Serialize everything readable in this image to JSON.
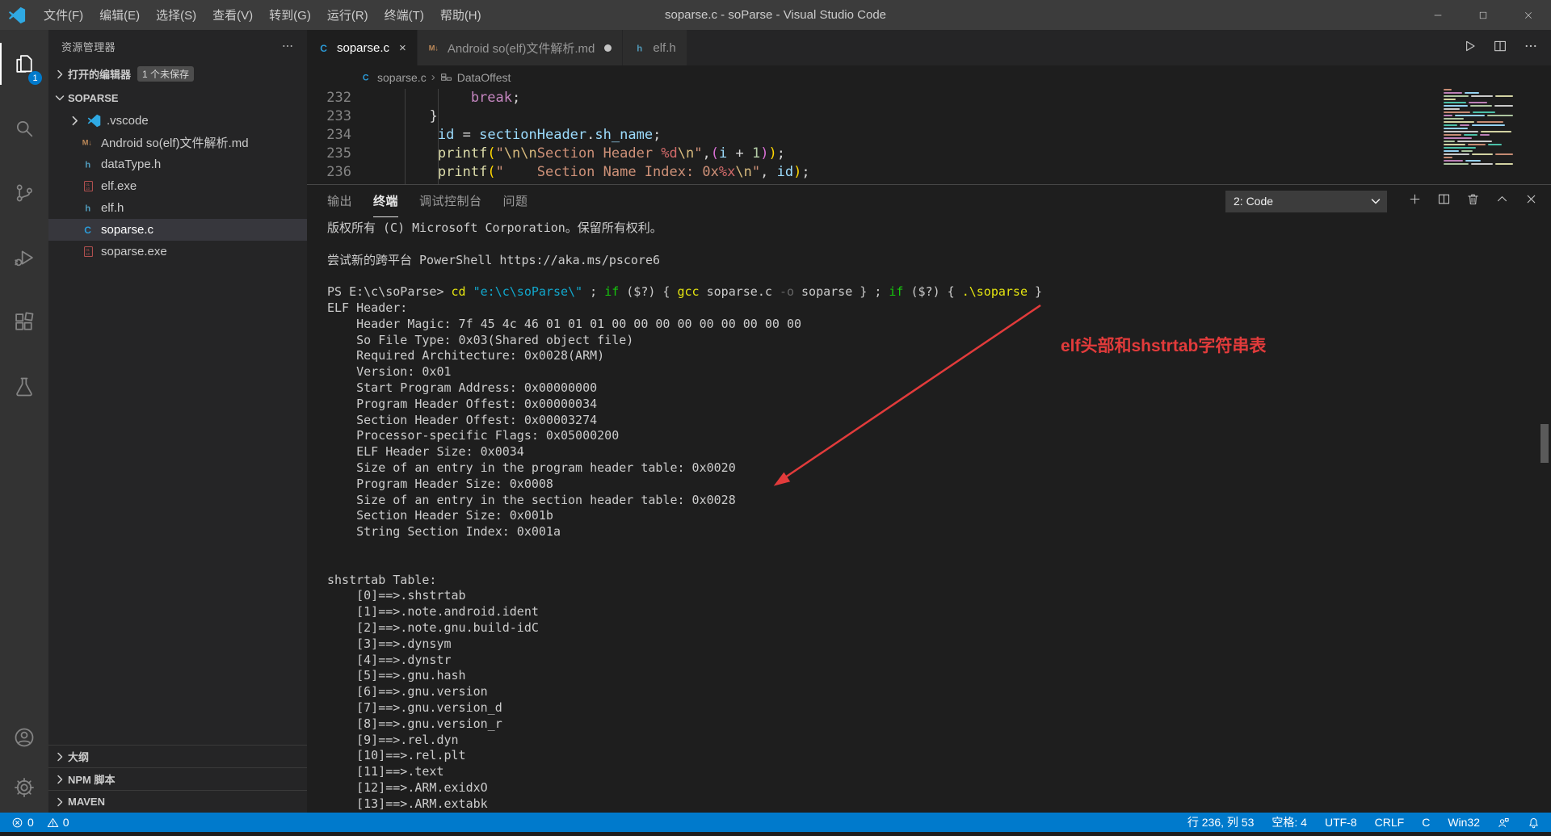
{
  "window": {
    "title": "soparse.c - soParse - Visual Studio Code",
    "controls": [
      "minimize",
      "maximize",
      "close"
    ]
  },
  "menu_bar": [
    "文件(F)",
    "编辑(E)",
    "选择(S)",
    "查看(V)",
    "转到(G)",
    "运行(R)",
    "终端(T)",
    "帮助(H)"
  ],
  "activity_bar": {
    "top": [
      {
        "icon": "files",
        "active": true,
        "badge": "1"
      },
      {
        "icon": "search"
      },
      {
        "icon": "source-control"
      },
      {
        "icon": "run-debug"
      },
      {
        "icon": "extensions"
      },
      {
        "icon": "test-beaker"
      }
    ],
    "bottom": [
      {
        "icon": "account"
      },
      {
        "icon": "settings-gear"
      }
    ]
  },
  "sidebar": {
    "title": "资源管理器",
    "open_editors": {
      "label": "打开的编辑器",
      "badge": "1 个未保存"
    },
    "project": {
      "label": "SOPARSE"
    },
    "files": [
      {
        "name": ".vscode",
        "icon": "vscode-folder",
        "chevron": true
      },
      {
        "name": "Android so(elf)文件解析.md",
        "icon": "markdown"
      },
      {
        "name": "dataType.h",
        "icon": "h-file"
      },
      {
        "name": "elf.exe",
        "icon": "exe-file"
      },
      {
        "name": "elf.h",
        "icon": "h-file"
      },
      {
        "name": "soparse.c",
        "icon": "c-file",
        "selected": true
      },
      {
        "name": "soparse.exe",
        "icon": "exe-file"
      }
    ],
    "bottom_sections": [
      "大纲",
      "NPM 脚本",
      "MAVEN"
    ]
  },
  "editor": {
    "tabs": [
      {
        "label": "soparse.c",
        "icon": "c-file",
        "active": true,
        "close": true
      },
      {
        "label": "Android so(elf)文件解析.md",
        "icon": "markdown",
        "dirty": true
      },
      {
        "label": "elf.h",
        "icon": "h-file"
      }
    ],
    "actions": [
      "run",
      "split-editor",
      "more-actions"
    ],
    "breadcrumb": {
      "file": "soparse.c",
      "symbol": "DataOffest"
    },
    "lines": [
      {
        "num": "232",
        "segments": [
          {
            "t": "            break",
            "c": "#C586C0"
          },
          {
            "t": ";",
            "c": "#D4D4D4"
          }
        ]
      },
      {
        "num": "233",
        "segments": [
          {
            "t": "       }",
            "c": "#D4D4D4"
          }
        ]
      },
      {
        "num": "234",
        "segments": [
          {
            "t": "        ",
            "c": "#D4D4D4"
          },
          {
            "t": "id",
            "c": "#9CDCFE"
          },
          {
            "t": " = ",
            "c": "#D4D4D4"
          },
          {
            "t": "sectionHeader",
            "c": "#9CDCFE"
          },
          {
            "t": ".",
            "c": "#D4D4D4"
          },
          {
            "t": "sh_name",
            "c": "#9CDCFE"
          },
          {
            "t": ";",
            "c": "#D4D4D4"
          }
        ]
      },
      {
        "num": "235",
        "segments": [
          {
            "t": "        ",
            "c": "#D4D4D4"
          },
          {
            "t": "printf",
            "c": "#DCDCAA"
          },
          {
            "t": "(",
            "c": "#FFD700"
          },
          {
            "t": "\"",
            "c": "#CE9178"
          },
          {
            "t": "\\n\\n",
            "c": "#D7BA7D"
          },
          {
            "t": "Section Header ",
            "c": "#CE9178"
          },
          {
            "t": "%d",
            "c": "#D16969"
          },
          {
            "t": "\\n",
            "c": "#D7BA7D"
          },
          {
            "t": "\"",
            "c": "#CE9178"
          },
          {
            "t": ",",
            "c": "#D4D4D4"
          },
          {
            "t": "(",
            "c": "#DA70D6"
          },
          {
            "t": "i",
            "c": "#9CDCFE"
          },
          {
            "t": " + ",
            "c": "#D4D4D4"
          },
          {
            "t": "1",
            "c": "#B5CEA8"
          },
          {
            "t": ")",
            "c": "#DA70D6"
          },
          {
            "t": ")",
            "c": "#FFD700"
          },
          {
            "t": ";",
            "c": "#D4D4D4"
          }
        ]
      },
      {
        "num": "236",
        "segments": [
          {
            "t": "        ",
            "c": "#D4D4D4"
          },
          {
            "t": "printf",
            "c": "#DCDCAA"
          },
          {
            "t": "(",
            "c": "#FFD700"
          },
          {
            "t": "\"    Section Name Index: 0x",
            "c": "#CE9178"
          },
          {
            "t": "%x",
            "c": "#D16969"
          },
          {
            "t": "\\n",
            "c": "#D7BA7D"
          },
          {
            "t": "\"",
            "c": "#CE9178"
          },
          {
            "t": ", ",
            "c": "#D4D4D4"
          },
          {
            "t": "id",
            "c": "#9CDCFE"
          },
          {
            "t": ")",
            "c": "#FFD700"
          },
          {
            "t": ";",
            "c": "#D4D4D4"
          }
        ]
      }
    ]
  },
  "panel": {
    "tabs": [
      {
        "label": "输出"
      },
      {
        "label": "终端",
        "active": true
      },
      {
        "label": "调试控制台"
      },
      {
        "label": "问题"
      }
    ],
    "dropdown": {
      "value": "2: Code"
    },
    "actions": [
      "new-terminal",
      "split-terminal",
      "kill-terminal",
      "maximize-panel",
      "close-panel"
    ],
    "terminal_lines": [
      {
        "s": [
          {
            "t": "版权所有 (C) Microsoft Corporation。保留所有权利。"
          }
        ]
      },
      {
        "s": [
          {
            "t": ""
          }
        ]
      },
      {
        "s": [
          {
            "t": "尝试新的跨平台 PowerShell https://aka.ms/pscore6"
          }
        ]
      },
      {
        "s": [
          {
            "t": ""
          }
        ]
      },
      {
        "s": [
          {
            "t": "PS E:\\c\\soParse> "
          },
          {
            "t": "cd",
            "c": "#E5E510"
          },
          {
            "t": " "
          },
          {
            "t": "\"e:\\c\\soParse\\\"",
            "c": "#11A8CD"
          },
          {
            "t": " ; "
          },
          {
            "t": "if",
            "c": "#16C60C"
          },
          {
            "t": " ($?) { "
          },
          {
            "t": "gcc",
            "c": "#E5E510"
          },
          {
            "t": " soparse.c "
          },
          {
            "t": "-o",
            "c": "#666666"
          },
          {
            "t": " soparse } ; "
          },
          {
            "t": "if",
            "c": "#16C60C"
          },
          {
            "t": " ($?) { "
          },
          {
            "t": ".\\soparse",
            "c": "#E5E510"
          },
          {
            "t": " }"
          }
        ]
      },
      {
        "s": [
          {
            "t": "ELF Header:"
          }
        ]
      },
      {
        "s": [
          {
            "t": "    Header Magic: 7f 45 4c 46 01 01 01 00 00 00 00 00 00 00 00 00"
          }
        ]
      },
      {
        "s": [
          {
            "t": "    So File Type: 0x03(Shared object file)"
          }
        ]
      },
      {
        "s": [
          {
            "t": "    Required Architecture: 0x0028(ARM)"
          }
        ]
      },
      {
        "s": [
          {
            "t": "    Version: 0x01"
          }
        ]
      },
      {
        "s": [
          {
            "t": "    Start Program Address: 0x00000000"
          }
        ]
      },
      {
        "s": [
          {
            "t": "    Program Header Offest: 0x00000034"
          }
        ]
      },
      {
        "s": [
          {
            "t": "    Section Header Offest: 0x00003274"
          }
        ]
      },
      {
        "s": [
          {
            "t": "    Processor-specific Flags: 0x05000200"
          }
        ]
      },
      {
        "s": [
          {
            "t": "    ELF Header Size: 0x0034"
          }
        ]
      },
      {
        "s": [
          {
            "t": "    Size of an entry in the program header table: 0x0020"
          }
        ]
      },
      {
        "s": [
          {
            "t": "    Program Header Size: 0x0008"
          }
        ]
      },
      {
        "s": [
          {
            "t": "    Size of an entry in the section header table: 0x0028"
          }
        ]
      },
      {
        "s": [
          {
            "t": "    Section Header Size: 0x001b"
          }
        ]
      },
      {
        "s": [
          {
            "t": "    String Section Index: 0x001a"
          }
        ]
      },
      {
        "s": [
          {
            "t": ""
          }
        ]
      },
      {
        "s": [
          {
            "t": ""
          }
        ]
      },
      {
        "s": [
          {
            "t": "shstrtab Table:"
          }
        ]
      },
      {
        "s": [
          {
            "t": "    [0]==>.shstrtab"
          }
        ]
      },
      {
        "s": [
          {
            "t": "    [1]==>.note.android.ident"
          }
        ]
      },
      {
        "s": [
          {
            "t": "    [2]==>.note.gnu.build-idC"
          }
        ]
      },
      {
        "s": [
          {
            "t": "    [3]==>.dynsym"
          }
        ]
      },
      {
        "s": [
          {
            "t": "    [4]==>.dynstr"
          }
        ]
      },
      {
        "s": [
          {
            "t": "    [5]==>.gnu.hash"
          }
        ]
      },
      {
        "s": [
          {
            "t": "    [6]==>.gnu.version"
          }
        ]
      },
      {
        "s": [
          {
            "t": "    [7]==>.gnu.version_d"
          }
        ]
      },
      {
        "s": [
          {
            "t": "    [8]==>.gnu.version_r"
          }
        ]
      },
      {
        "s": [
          {
            "t": "    [9]==>.rel.dyn"
          }
        ]
      },
      {
        "s": [
          {
            "t": "    [10]==>.rel.plt"
          }
        ]
      },
      {
        "s": [
          {
            "t": "    [11]==>.text"
          }
        ]
      },
      {
        "s": [
          {
            "t": "    [12]==>.ARM.exidxO"
          }
        ]
      },
      {
        "s": [
          {
            "t": "    [13]==>.ARM.extabk"
          }
        ]
      }
    ]
  },
  "annotation": {
    "text": "elf头部和shstrtab字符串表",
    "color": "#E23B3B"
  },
  "status_bar": {
    "left": [
      {
        "icon": "error",
        "text": "0"
      },
      {
        "icon": "warning",
        "text": "0"
      }
    ],
    "right": [
      {
        "text": "行 236, 列 53"
      },
      {
        "text": "空格: 4"
      },
      {
        "text": "UTF-8"
      },
      {
        "text": "CRLF"
      },
      {
        "text": "C"
      },
      {
        "text": "Win32"
      },
      {
        "icon": "feedback"
      },
      {
        "icon": "bell"
      }
    ]
  }
}
